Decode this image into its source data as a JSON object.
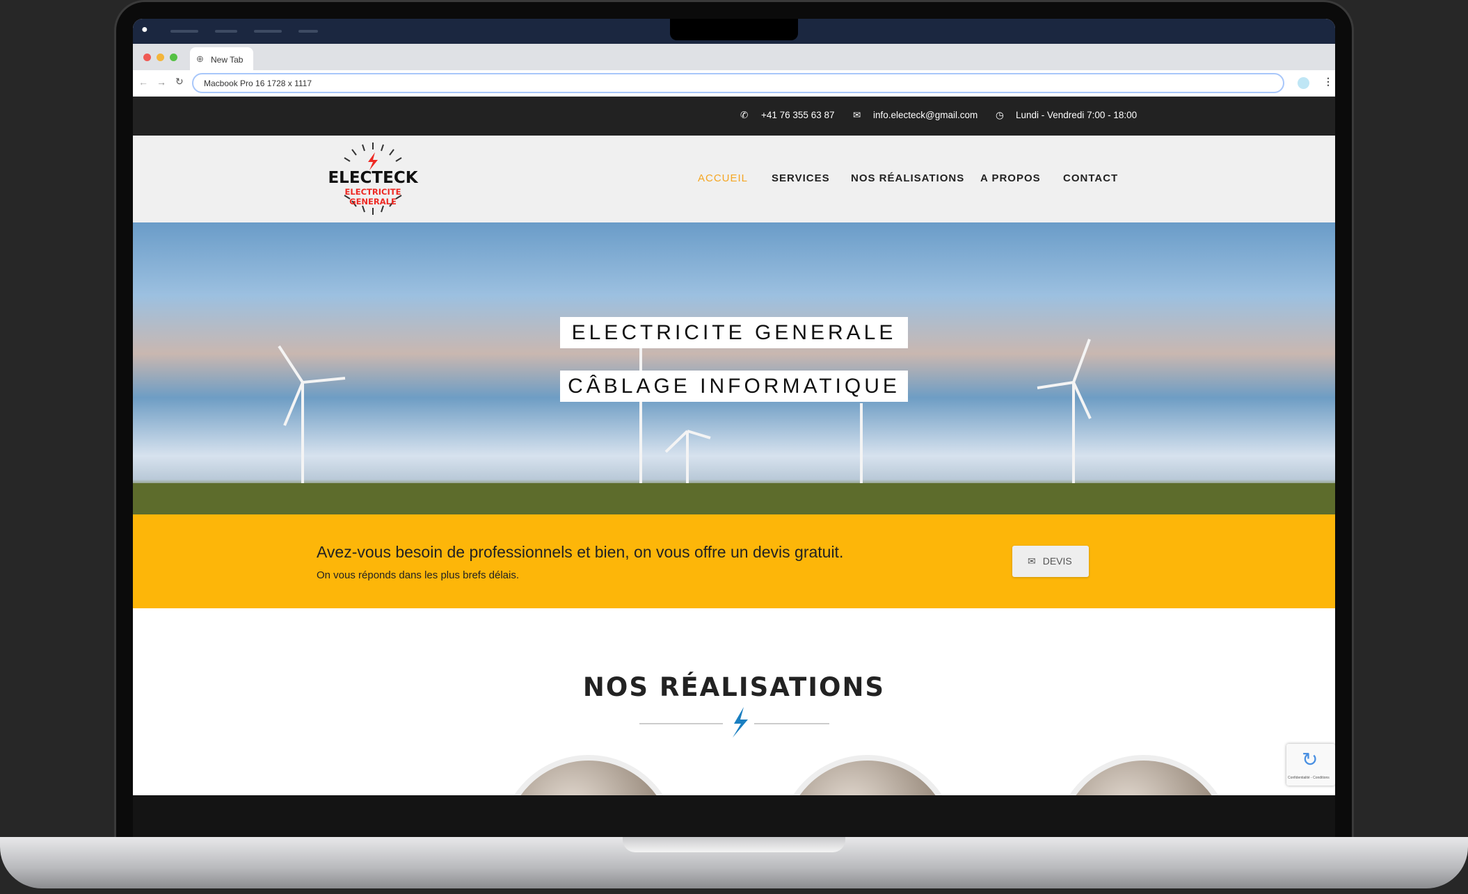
{
  "browser": {
    "tab_title": "New Tab",
    "address": "Macbook Pro 16  1728 x 1117"
  },
  "topbar": {
    "phone": "+41 76 355 63 87",
    "email": "info.electeck@gmail.com",
    "hours": "Lundi - Vendredi 7:00 - 18:00"
  },
  "logo": {
    "name": "ELECTECK",
    "tagline": "ELECTRICITE GENERALE"
  },
  "nav": {
    "items": [
      {
        "label": "ACCUEIL",
        "active": true
      },
      {
        "label": "SERVICES"
      },
      {
        "label": "NOS RÉALISATIONS"
      },
      {
        "label": "A PROPOS"
      },
      {
        "label": "CONTACT"
      }
    ]
  },
  "hero": {
    "line1": "ELECTRICITE GENERALE",
    "line2": "CÂBLAGE INFORMATIQUE"
  },
  "cta": {
    "headline": "Avez-vous besoin de professionnels et bien, on vous offre un devis gratuit.",
    "sub": "On vous réponds dans les plus brefs délais.",
    "button": "DEVIS"
  },
  "section": {
    "title": "NOS RÉALISATIONS"
  },
  "recaptcha": {
    "text": "Confidentialité - Conditions"
  },
  "colors": {
    "accent": "#fdb609",
    "nav_active": "#f5a623",
    "topbar": "#222222",
    "divider_icon": "#1a7fc1",
    "logo_red": "#ee2a24"
  }
}
